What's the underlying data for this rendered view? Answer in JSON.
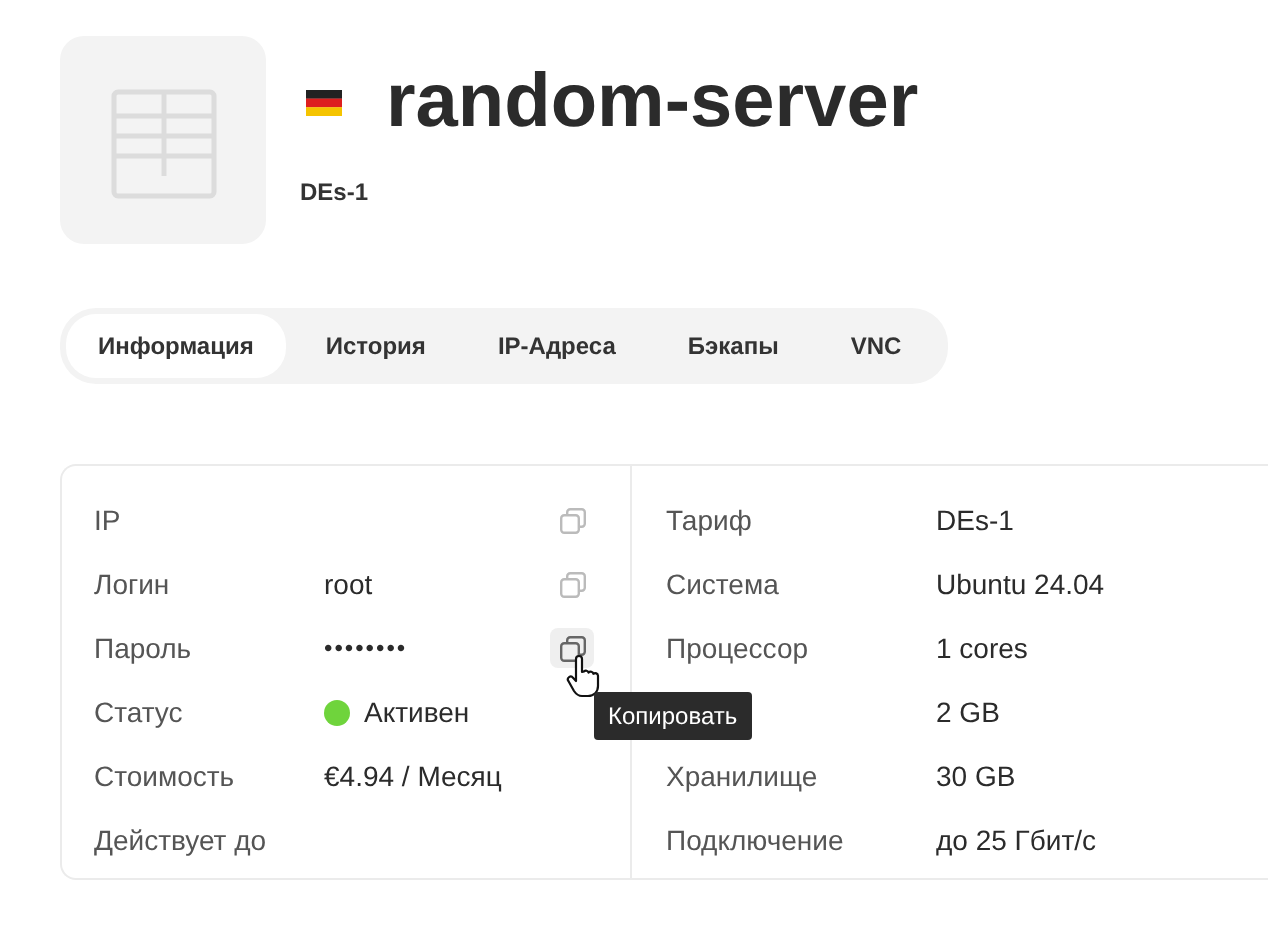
{
  "server": {
    "name": "random-server",
    "plan": "DEs-1"
  },
  "tabs": [
    {
      "label": "Информация",
      "selected": true
    },
    {
      "label": "История",
      "selected": false
    },
    {
      "label": "IP-Адреса",
      "selected": false
    },
    {
      "label": "Бэкапы",
      "selected": false
    },
    {
      "label": "VNC",
      "selected": false
    }
  ],
  "details_left": [
    {
      "kind": "text",
      "label": "IP",
      "copy": true,
      "hovered": false
    },
    {
      "kind": "text",
      "label": "Логин",
      "value": "root",
      "copy": true,
      "hovered": false
    },
    {
      "kind": "password",
      "label": "Пароль",
      "value": "••••••••",
      "copy": true,
      "hovered": true
    },
    {
      "kind": "status",
      "label": "Статус",
      "value": "Активен",
      "color": "#6fd43c",
      "copy": false
    },
    {
      "kind": "text",
      "label": "Стоимость",
      "value": "€4.94 / Месяц",
      "copy": false
    },
    {
      "kind": "text",
      "label": "Действует до",
      "copy": false
    }
  ],
  "details_right": [
    {
      "label": "Тариф",
      "value": "DEs-1"
    },
    {
      "label": "Система",
      "value": "Ubuntu 24.04"
    },
    {
      "label": "Процессор",
      "value": "1 cores"
    },
    {
      "value": "2 GB"
    },
    {
      "label": "Хранилище",
      "value": "30 GB"
    },
    {
      "label": "Подключение",
      "value": "до 25 Гбит/с"
    }
  ],
  "tooltip": {
    "text": "Копировать"
  }
}
